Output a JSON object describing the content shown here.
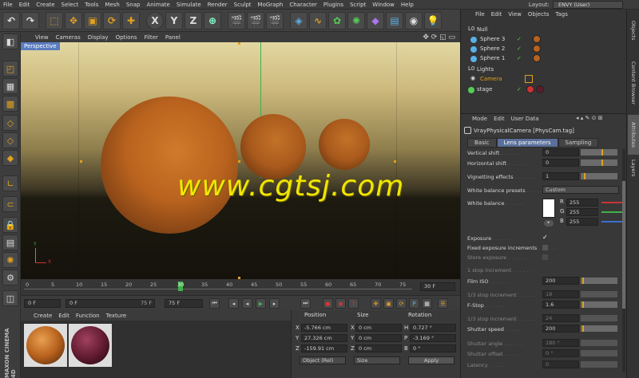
{
  "menu": [
    "File",
    "Edit",
    "Create",
    "Select",
    "Tools",
    "Mesh",
    "Snap",
    "Animate",
    "Simulate",
    "Render",
    "Sculpt",
    "MoGraph",
    "Character",
    "Plugins",
    "Script",
    "Window",
    "Help"
  ],
  "layout": {
    "label": "Layout:",
    "value": "ENVY (User)"
  },
  "viewport": {
    "menu": [
      "View",
      "Cameras",
      "Display",
      "Options",
      "Filter",
      "Panel"
    ],
    "label": "Perspective",
    "axis_y": "Y",
    "axis_x": "X"
  },
  "timeline": {
    "ticks": [
      "0",
      "5",
      "10",
      "15",
      "20",
      "25",
      "30",
      "35",
      "40",
      "45",
      "50",
      "55",
      "60",
      "65",
      "70",
      "75"
    ],
    "current_frame": "30 F"
  },
  "playback": {
    "start": "0 F",
    "min": "0 F",
    "max": "75 F",
    "end": "75 F"
  },
  "material_manager": {
    "menu": [
      "Create",
      "Edit",
      "Function",
      "Texture"
    ]
  },
  "brand": "MAXON CINEMA 4D",
  "coordinates": {
    "headers": [
      "Position",
      "Size",
      "Rotation"
    ],
    "rows": [
      {
        "axis": "X",
        "pos": "-5.766 cm",
        "size_axis": "X",
        "size": "0 cm",
        "rot_axis": "H",
        "rot": "0.727 °"
      },
      {
        "axis": "Y",
        "pos": "27.326 cm",
        "size_axis": "Y",
        "size": "0 cm",
        "rot_axis": "P",
        "rot": "-3.169 °"
      },
      {
        "axis": "Z",
        "pos": "-159.91 cm",
        "size_axis": "Z",
        "size": "0 cm",
        "rot_axis": "B",
        "rot": "0 °"
      }
    ],
    "mode": "Object (Rel)",
    "size_mode": "Size",
    "apply": "Apply"
  },
  "object_manager": {
    "menu": [
      "File",
      "Edit",
      "View",
      "Objects",
      "Tags"
    ],
    "objects": [
      {
        "name": "Null"
      },
      {
        "name": "Sphere 3"
      },
      {
        "name": "Sphere 2"
      },
      {
        "name": "Sphere 1"
      },
      {
        "name": "Lights"
      },
      {
        "name": "Camera"
      },
      {
        "name": "stage"
      }
    ]
  },
  "attributes": {
    "menu": [
      "Mode",
      "Edit",
      "User Data"
    ],
    "title": "VrayPhysicalCamera [PhysCam.tag]",
    "tabs": [
      "Basic",
      "Lens parameters",
      "Sampling"
    ],
    "active_tab": "Lens parameters",
    "rows": [
      {
        "label": "Vertical shift",
        "value": "0"
      },
      {
        "label": "Horizontal shift",
        "value": "0"
      },
      {
        "label": "Vignetting effects",
        "value": "1"
      },
      {
        "label": "White balance presets",
        "value": "Custom"
      },
      {
        "label": "White balance"
      },
      {
        "label": "Exposure",
        "value": "✓"
      },
      {
        "label": "Fixed exposure increments"
      },
      {
        "label": "Store exposure"
      },
      {
        "label": "1 stop increment"
      },
      {
        "label": "Film ISO",
        "value": "200"
      },
      {
        "label": "1/3 stop increment",
        "value": "18"
      },
      {
        "label": "F-Stop",
        "value": "1.6"
      },
      {
        "label": "1/3 stop increment",
        "value": "24"
      },
      {
        "label": "Shutter speed",
        "value": "200"
      },
      {
        "label": "Shutter angle",
        "value": "180 °"
      },
      {
        "label": "Shutter offset",
        "value": "0 °"
      },
      {
        "label": "Latency",
        "value": "0"
      }
    ],
    "rgb": [
      {
        "ch": "R",
        "value": "255"
      },
      {
        "ch": "G",
        "value": "255"
      },
      {
        "ch": "B",
        "value": "255"
      }
    ]
  },
  "right_tabs": [
    "Objects",
    "Content Browser",
    "Attributes",
    "Layers"
  ],
  "watermark": "www.cgtsj.com",
  "colors": {
    "accent": "#e0a020",
    "sphere": "#b8621e",
    "selection": "#5a7cc0"
  }
}
